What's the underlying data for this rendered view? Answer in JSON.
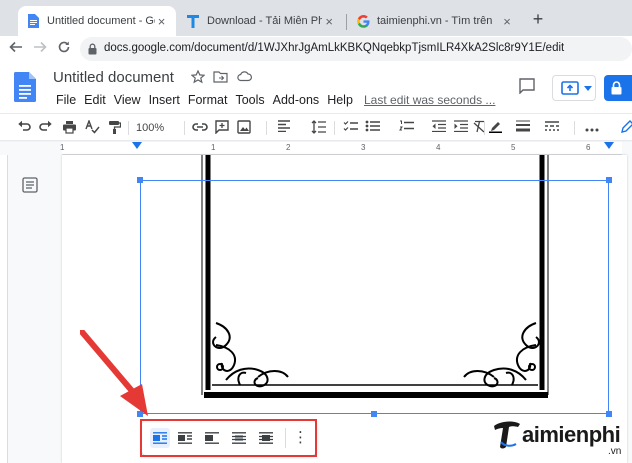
{
  "browser": {
    "tabs": [
      {
        "title": "Untitled document - Google",
        "favicon": "google-docs-icon",
        "active": true
      },
      {
        "title": "Download - Tải Miễn Phí VN",
        "favicon": "taimienphi-t-icon",
        "active": false
      },
      {
        "title": "taimienphi.vn - Tìm trên Goo",
        "favicon": "google-g-icon",
        "active": false
      }
    ],
    "new_tab_label": "+",
    "close_label": "×",
    "url": "docs.google.com/document/d/1WJXhrJgAmLkKBKQNqebkpTjsmILR4XkA2Slc8r9Y1E/edit"
  },
  "docs": {
    "title": "Untitled document",
    "menu": [
      "File",
      "Edit",
      "View",
      "Insert",
      "Format",
      "Tools",
      "Add-ons",
      "Help"
    ],
    "last_edit": "Last edit was seconds ...",
    "zoom": "100%"
  },
  "ruler": {
    "numbers": [
      "1",
      "1",
      "2",
      "3",
      "4",
      "5",
      "6"
    ]
  },
  "image_toolbar": {
    "buttons": [
      "wrap-inline",
      "wrap-text",
      "break-text",
      "behind-text",
      "in-front-of-text"
    ],
    "selected": "wrap-inline",
    "more_label": "⋮"
  },
  "watermark": {
    "brand": "aimienphi",
    "brand_initial": "T",
    "suffix": ".vn"
  },
  "colors": {
    "selection": "#4285f4",
    "highlight": "#e53935",
    "share": "#1a73e8",
    "docs_blue": "#4285f4"
  }
}
